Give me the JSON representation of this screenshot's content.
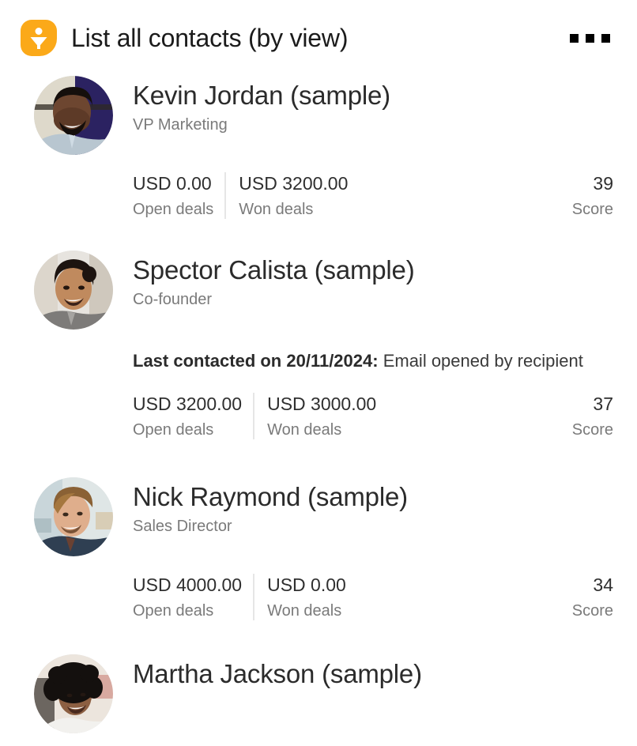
{
  "header": {
    "icon": "funnel-filter-icon",
    "icon_color": "#FBA919",
    "title": "List all contacts (by view)",
    "overflow_menu": "more-options"
  },
  "metric_labels": {
    "open": "Open deals",
    "won": "Won deals",
    "score": "Score"
  },
  "contacts": [
    {
      "name": "Kevin Jordan (sample)",
      "role": "VP Marketing",
      "note": null,
      "note_bold": null,
      "open_deals": "USD 0.00",
      "won_deals": "USD 3200.00",
      "score": "39"
    },
    {
      "name": "Spector Calista (sample)",
      "role": "Co-founder",
      "note_bold": "Last contacted on 20/11/2024:",
      "note": " Email opened by recipient",
      "open_deals": "USD 3200.00",
      "won_deals": "USD 3000.00",
      "score": "37"
    },
    {
      "name": "Nick Raymond (sample)",
      "role": "Sales Director",
      "note": null,
      "note_bold": null,
      "open_deals": "USD 4000.00",
      "won_deals": "USD 0.00",
      "score": "34"
    },
    {
      "name": "Martha Jackson (sample)",
      "role": null,
      "note": null,
      "note_bold": null,
      "open_deals": null,
      "won_deals": null,
      "score": null
    }
  ]
}
